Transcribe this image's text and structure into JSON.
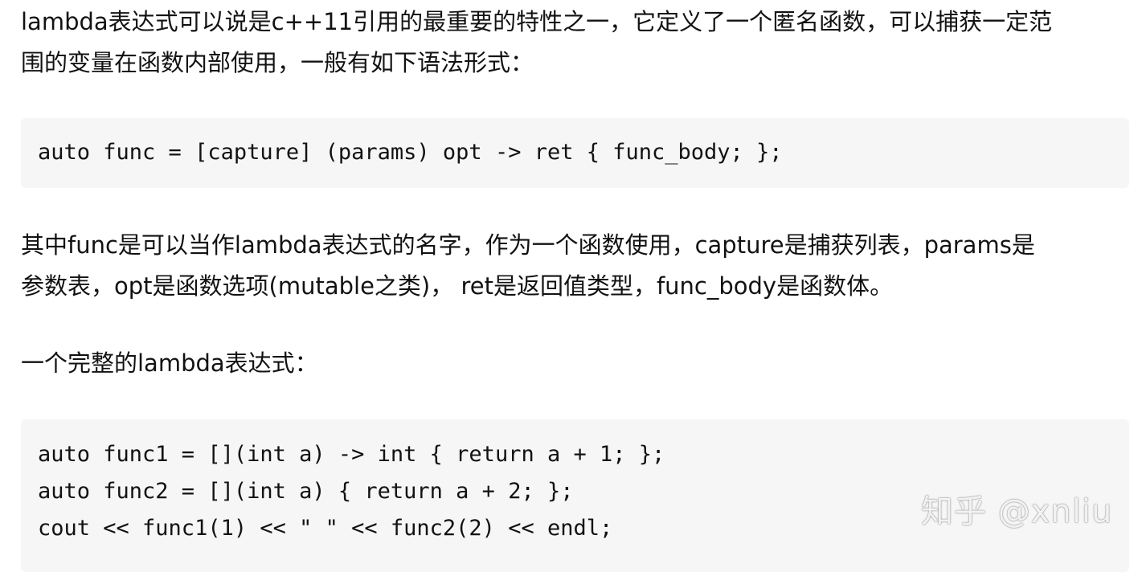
{
  "paragraphs": {
    "intro": [
      "lambda表达式可以说是c++11引用的最重要的特性之一，它定义了一个匿名函数，可以捕获一定范",
      "围的变量在函数内部使用，一般有如下语法形式："
    ],
    "explanation": [
      "其中func是可以当作lambda表达式的名字，作为一个函数使用，capture是捕获列表，params是",
      "参数表，opt是函数选项(mutable之类)， ret是返回值类型，func_body是函数体。"
    ],
    "example_heading": "一个完整的lambda表达式："
  },
  "code": {
    "syntax": "auto func = [capture] (params) opt -> ret { func_body; };",
    "example": [
      "auto func1 = [](int a) -> int { return a + 1; };",
      "auto func2 = [](int a) { return a + 2; };",
      "cout << func1(1) << \" \" << func2(2) << endl;"
    ]
  },
  "watermark": "知乎 @xnliu"
}
